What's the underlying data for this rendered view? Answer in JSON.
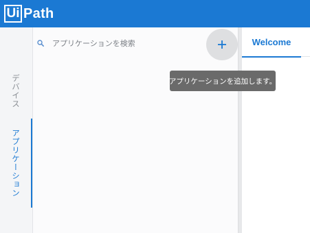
{
  "app": {
    "logo_boxed": "Ui",
    "logo_rest": "Path",
    "header_color": "#1b79d3"
  },
  "sidebar": {
    "tabs": [
      {
        "label": "デバイス",
        "active": false
      },
      {
        "label": "アプリケーション",
        "active": true
      }
    ]
  },
  "apps_panel": {
    "search": {
      "placeholder": "アプリケーションを検索",
      "value": "",
      "icon": "search-icon"
    },
    "add_button": {
      "icon": "plus-icon"
    }
  },
  "tooltip": {
    "text": "アプリケーションを追加します。"
  },
  "right_panel": {
    "tabs": [
      {
        "label": "Welcome",
        "active": true
      }
    ]
  }
}
